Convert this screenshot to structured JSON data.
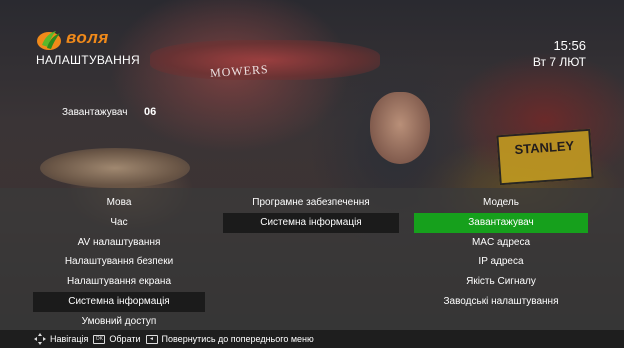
{
  "header": {
    "brand": "воля",
    "page_title": "НАЛАШТУВАННЯ",
    "time": "15:56",
    "date": "Вт 7 ЛЮТ"
  },
  "status": {
    "label": "Завантажувач",
    "value": "06"
  },
  "background": {
    "sign_mowers": "MOWERS",
    "sign_stanley": "STANLEY"
  },
  "menu": {
    "left": [
      "Мова",
      "Час",
      "AV налаштування",
      "Налаштування безпеки",
      "Налаштування екрана",
      "Системна інформація",
      "Умовний доступ"
    ],
    "middle": [
      "Програмне забезпечення",
      "Системна інформація"
    ],
    "right": [
      "Модель",
      "Завантажувач",
      "MAC адреса",
      "IP адреса",
      "Якість Сигналу",
      "Заводські налаштування"
    ]
  },
  "footer": {
    "nav": "Навігація",
    "ok": "Обрати",
    "back": "Повернутись до попереднього меню"
  },
  "colors": {
    "brand_orange": "#f08a1a",
    "selected_green": "#16a01c",
    "selected_dark": "#1b1b1b"
  }
}
